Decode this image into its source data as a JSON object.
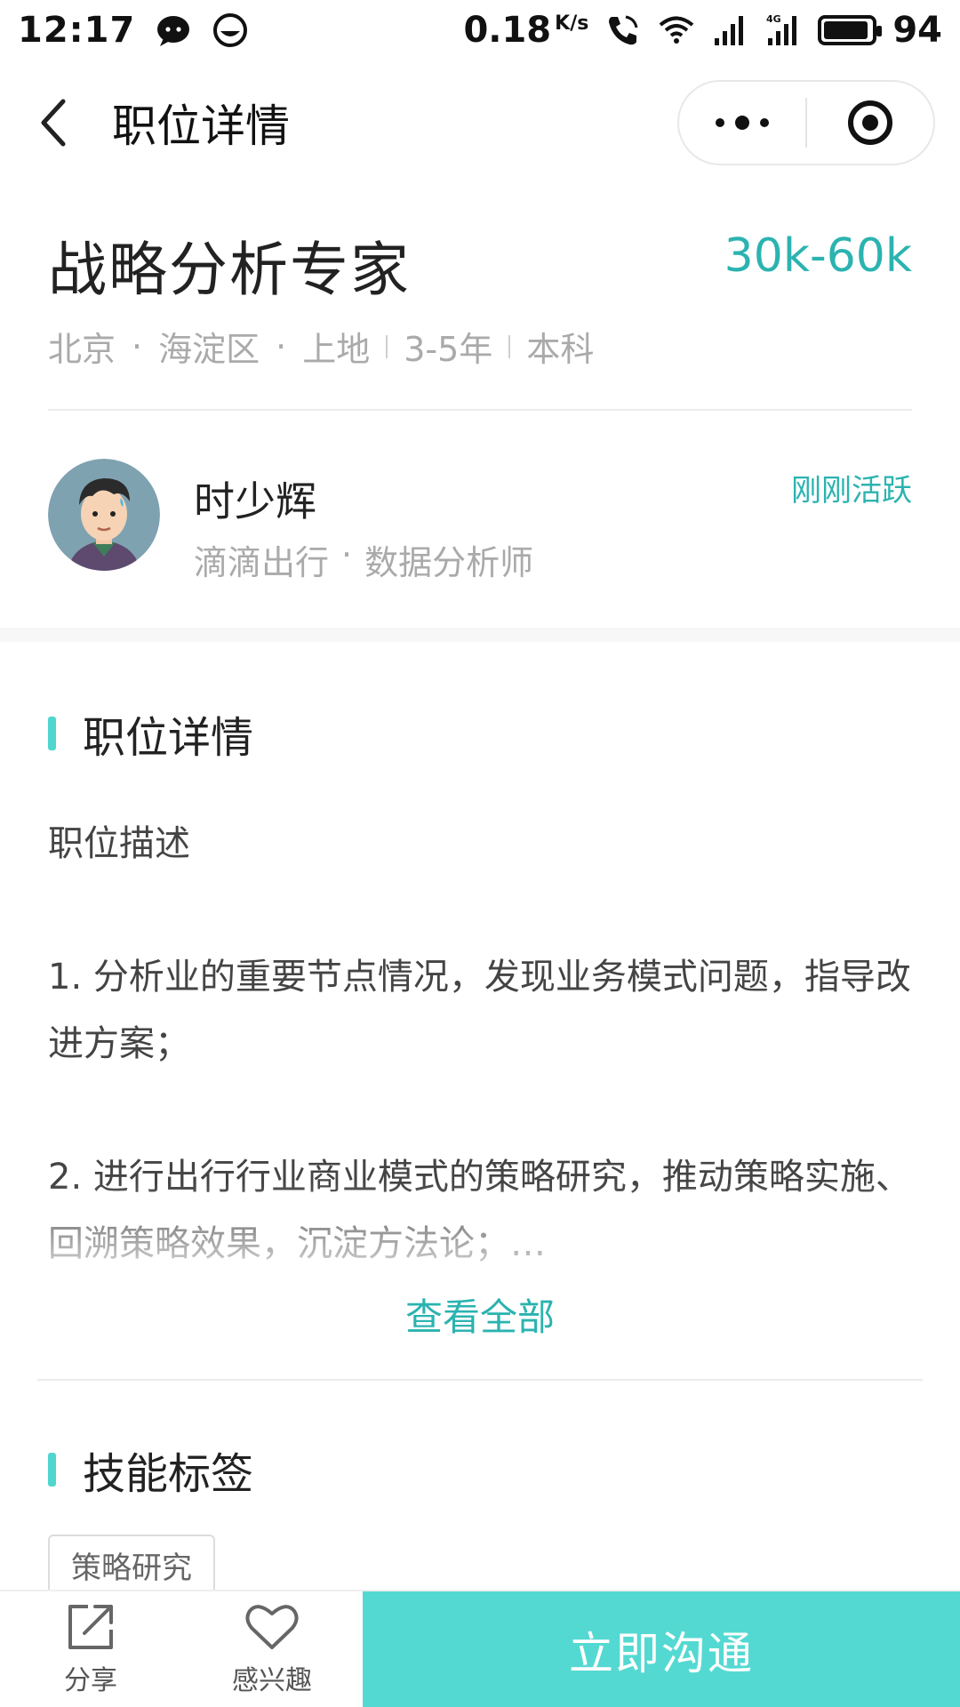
{
  "status_bar": {
    "time": "12:17",
    "net_speed": "0.18",
    "net_unit": "K/s",
    "battery": "94"
  },
  "nav": {
    "title": "职位详情"
  },
  "job": {
    "title": "战略分析专家",
    "salary": "30k-60k",
    "city": "北京",
    "district": "海淀区",
    "area": "上地",
    "experience": "3-5年",
    "education": "本科",
    "dot": "·"
  },
  "recruiter": {
    "name": "时少辉",
    "company": "滴滴出行",
    "role": "数据分析师",
    "active": "刚刚活跃"
  },
  "details": {
    "section_title": "职位详情",
    "heading": "职位描述",
    "item1": "1. 分析业的重要节点情况，发现业务模式问题，指导改进方案；",
    "item2": "2. 进行出行行业商业模式的策略研究，推动策略实施、回溯策略效果，沉淀方法论；…",
    "view_all": "查看全部"
  },
  "skills": {
    "section_title": "技能标签",
    "tags": [
      "策略研究"
    ]
  },
  "bottom": {
    "share": "分享",
    "interest": "感兴趣",
    "contact": "立即沟通"
  },
  "colors": {
    "accent": "#2bb3b0",
    "cta": "#54d9d2"
  }
}
